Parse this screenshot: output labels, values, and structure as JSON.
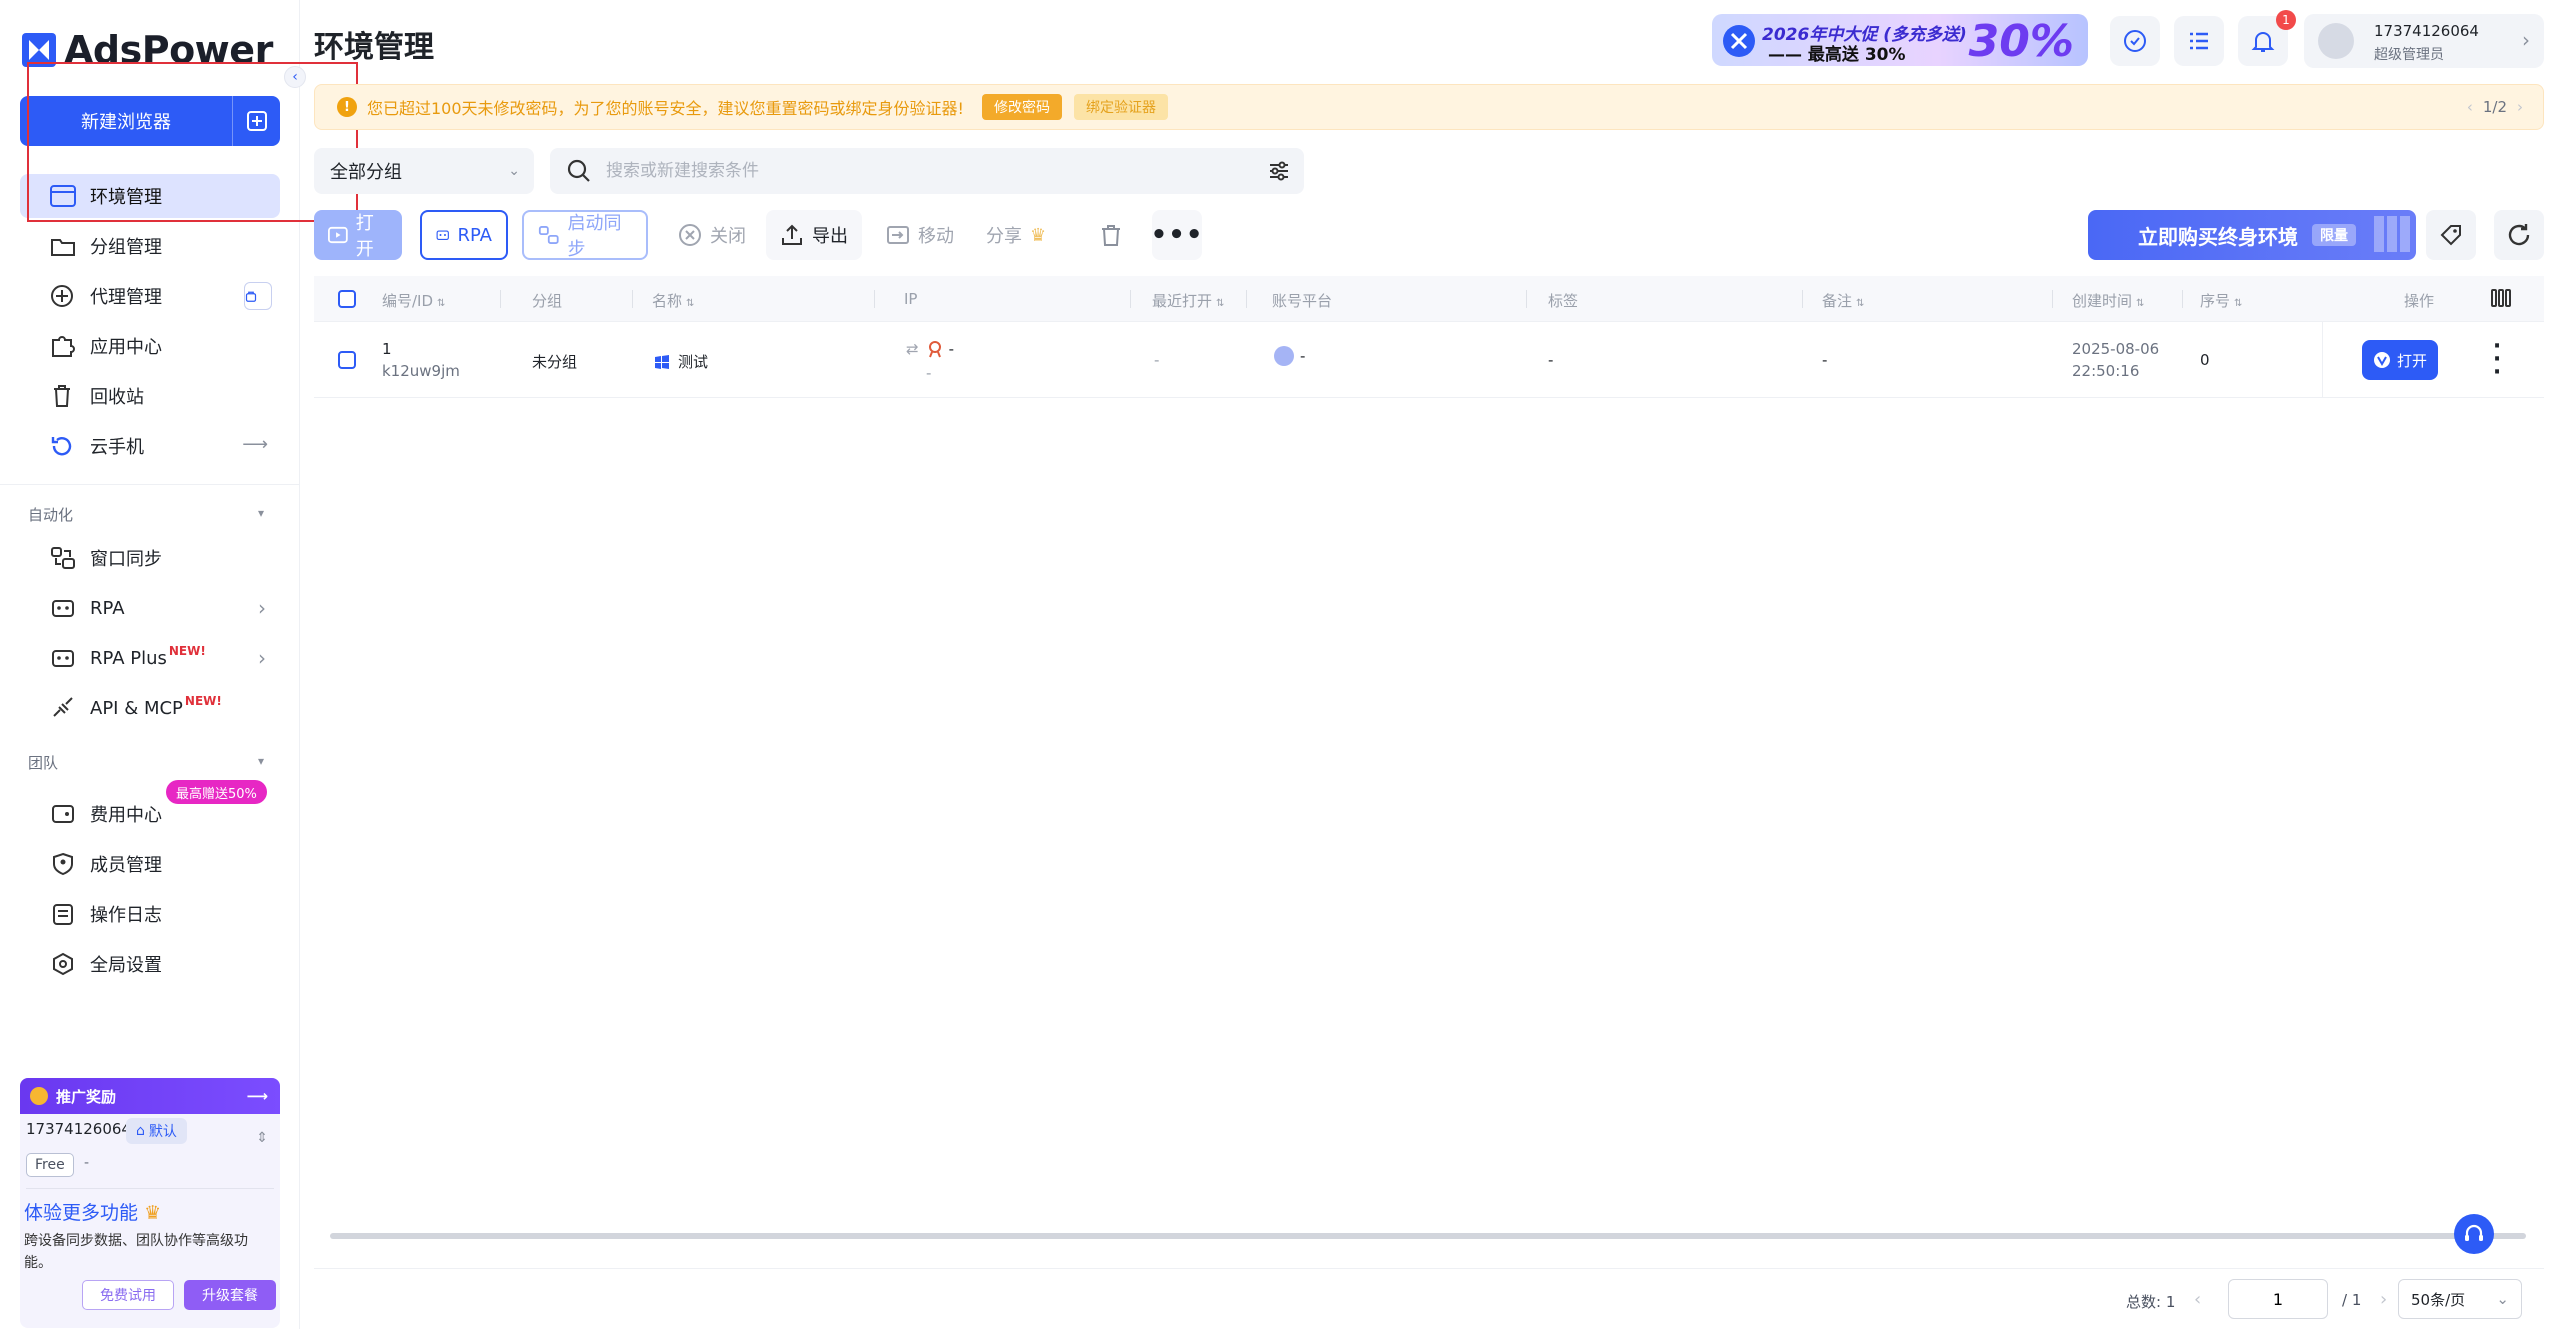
{
  "app": {
    "logo_text": "AdsPower",
    "brand_color": "#2d5bf6"
  },
  "sidebar": {
    "new_browser": "新建浏览器",
    "nav": [
      {
        "label": "环境管理",
        "icon": "browser-window-icon",
        "active": true
      },
      {
        "label": "分组管理",
        "icon": "folder-icon"
      },
      {
        "label": "代理管理",
        "icon": "proxy-icon"
      },
      {
        "label": "应用中心",
        "icon": "puzzle-icon"
      },
      {
        "label": "回收站",
        "icon": "trash-icon"
      },
      {
        "label": "云手机",
        "icon": "cloud-phone-icon"
      }
    ],
    "automation_title": "自动化",
    "automation": [
      {
        "label": "窗口同步",
        "icon": "sync-windows-icon"
      },
      {
        "label": "RPA",
        "icon": "robot-icon"
      },
      {
        "label": "RPA Plus",
        "icon": "robot-icon",
        "badge": "NEW!"
      },
      {
        "label": "API & MCP",
        "icon": "api-icon",
        "badge": "NEW!"
      }
    ],
    "team_title": "团队",
    "team": [
      {
        "label": "费用中心",
        "icon": "wallet-icon"
      },
      {
        "label": "成员管理",
        "icon": "shield-user-icon"
      },
      {
        "label": "操作日志",
        "icon": "log-icon"
      },
      {
        "label": "全局设置",
        "icon": "settings-hex-icon"
      }
    ],
    "discount_badge": "最高赠送50%",
    "promo": {
      "header": "推广奖励",
      "account": "17374126064",
      "account_tag": "默认",
      "plan": "Free",
      "plan_extra": "-",
      "title": "体验更多功能",
      "desc": "跨设备同步数据、团队协作等高级功能。",
      "trial": "免费试用",
      "upgrade": "升级套餐"
    }
  },
  "header": {
    "title": "环境管理",
    "ad_line1": "2026年中大促 (多充多送)",
    "ad_line2": "—— 最高送 30%",
    "ad_big": "30%",
    "notification_count": "1",
    "user_phone": "17374126064",
    "user_role": "超级管理员"
  },
  "notice": {
    "text": "您已超过100天未修改密码，为了您的账号安全，建议您重置密码或绑定身份验证器!",
    "btn_password": "修改密码",
    "btn_auth": "绑定验证器",
    "pager": "1/2"
  },
  "filters": {
    "group": "全部分组",
    "search_placeholder": "搜索或新建搜索条件"
  },
  "toolbar": {
    "open": "打开",
    "rpa": "RPA",
    "sync": "启动同步",
    "close": "关闭",
    "export": "导出",
    "move": "移动",
    "share": "分享",
    "buy": "立即购买终身环境",
    "buy_tag": "限量"
  },
  "table": {
    "columns": [
      "编号/ID",
      "分组",
      "名称",
      "IP",
      "最近打开",
      "账号平台",
      "标签",
      "备注",
      "创建时间",
      "序号",
      "操作"
    ],
    "rows": [
      {
        "num": "1",
        "id": "k12uw9jm",
        "group": "未分组",
        "name": "测试",
        "ip": "-",
        "ip_sub": "-",
        "last_open": "-",
        "platform": "-",
        "tags": "-",
        "remark": "-",
        "created_date": "2025-08-06",
        "created_time": "22:50:16",
        "seq": "0",
        "action": "打开"
      }
    ]
  },
  "footer": {
    "total": "总数: 1",
    "page": "1",
    "of": "/ 1",
    "page_size": "50条/页"
  }
}
